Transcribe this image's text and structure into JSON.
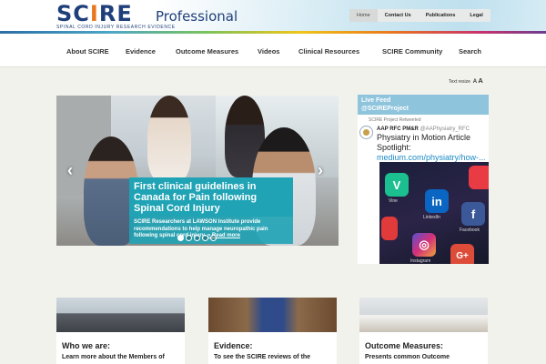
{
  "brand": {
    "logo": "SCIRE",
    "tagline": "SPINAL CORD INJURY RESEARCH EVIDENCE",
    "product": "Professional"
  },
  "topnav": [
    "Home",
    "Contact Us",
    "Publications",
    "Legal"
  ],
  "mainnav": [
    "About SCIRE",
    "Evidence",
    "Outcome Measures",
    "Videos",
    "Clinical Resources",
    "SCIRE Community",
    "Search"
  ],
  "text_resize": {
    "label": "Text resize",
    "small": "A",
    "large": "A"
  },
  "carousel": {
    "title": "First clinical guidelines in Canada for Pain following Spinal Cord Injury",
    "body": "SCIRE Researchers at LAWSON Institute provide recommendations to help manage neuropathic pain following spinal cord injury.",
    "more": "» Read more",
    "prev": "‹",
    "next": "›",
    "slides": 5,
    "active_slide": 1
  },
  "feed": {
    "title": "Live Feed",
    "handle": "@SCIREProject",
    "retweet": "SCIRE Project Retweeted",
    "author": "AAP RFC PM&R",
    "author_handle": "@AAPhysiatry_RFC",
    "text": "Physiatry in Motion Article Spotlight:",
    "link": "medium.com/physiatry/how-...",
    "apps": [
      "Vine",
      "LinkedIn",
      "Facebook",
      "Instagram",
      "Google+"
    ]
  },
  "cards": [
    {
      "title": "Who we are:",
      "text": "Learn more about the Members of"
    },
    {
      "title": "Evidence:",
      "text": "To see the SCIRE reviews of the"
    },
    {
      "title": "Outcome Measures:",
      "text": "Presents common Outcome"
    }
  ]
}
